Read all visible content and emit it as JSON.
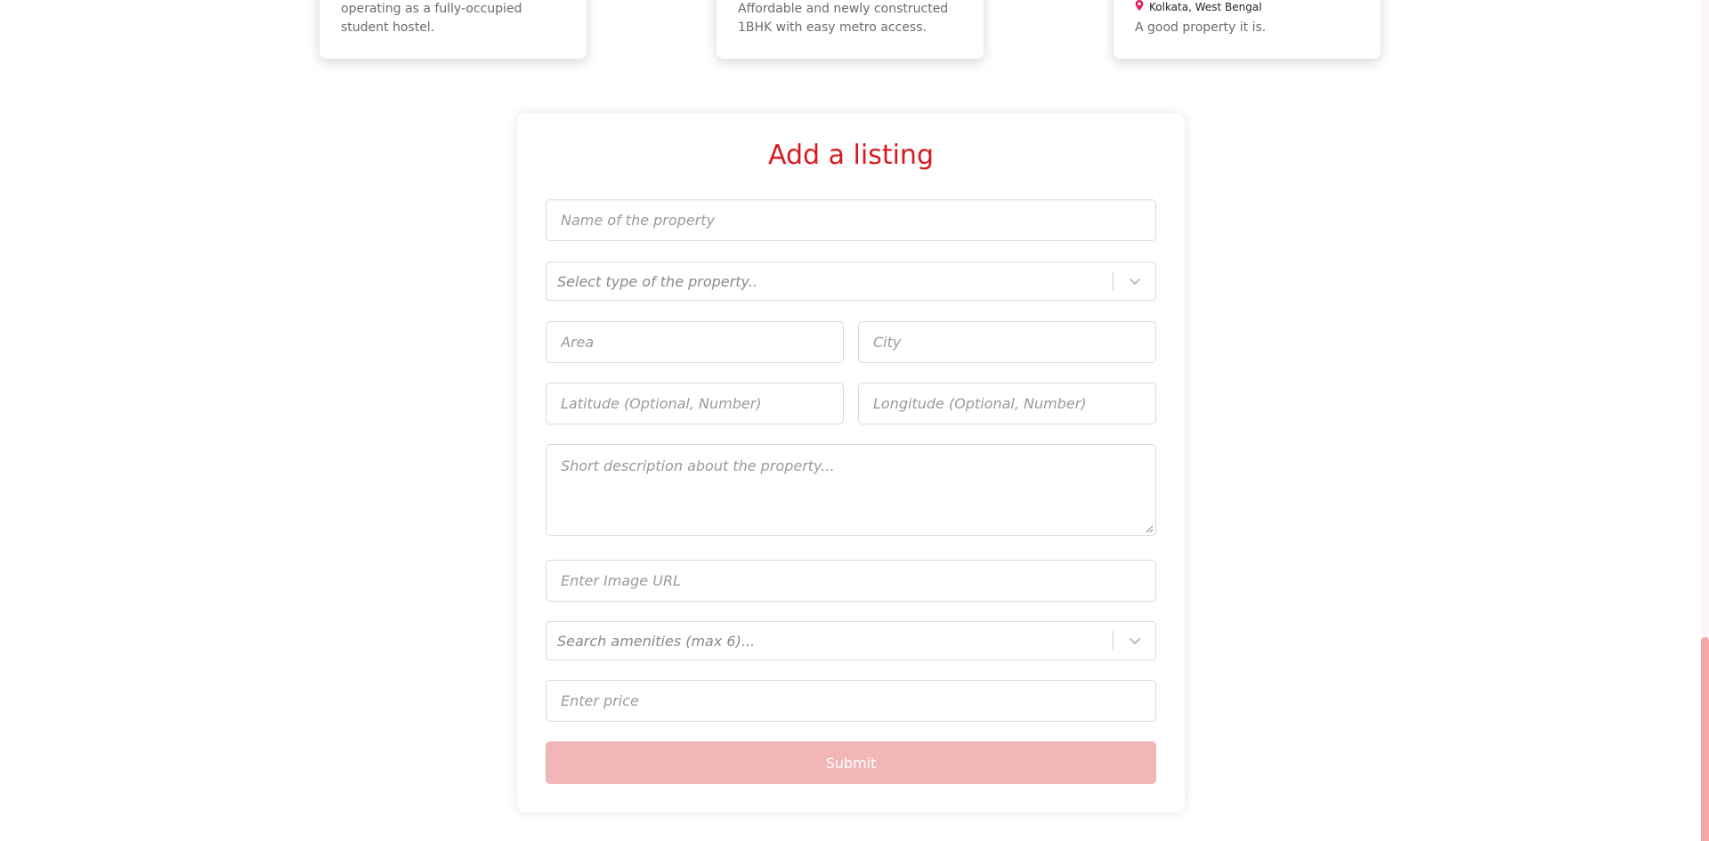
{
  "cards": [
    {
      "description": "operating as a fully-occupied student hostel."
    },
    {
      "description": "Affordable and newly constructed 1BHK with easy metro access."
    },
    {
      "location": "Kolkata, West Bengal",
      "description": "A good property it is."
    }
  ],
  "form": {
    "title": "Add a listing",
    "name_placeholder": "Name of the property",
    "type_select_placeholder": "Select type of the property..",
    "area_placeholder": "Area",
    "city_placeholder": "City",
    "latitude_placeholder": "Latitude (Optional, Number)",
    "longitude_placeholder": "Longitude (Optional, Number)",
    "description_placeholder": "Short description about the property...",
    "image_url_placeholder": "Enter Image URL",
    "amenities_select_placeholder": "Search amenities (max 6)...",
    "price_placeholder": "Enter price",
    "submit_label": "Submit"
  },
  "colors": {
    "accent": "#d71920",
    "submit_disabled": "#f2b6b6",
    "scroll_thumb": "#f3a7a7"
  },
  "icons": {
    "location": "map-pin-icon",
    "dropdown": "chevron-down-icon"
  }
}
